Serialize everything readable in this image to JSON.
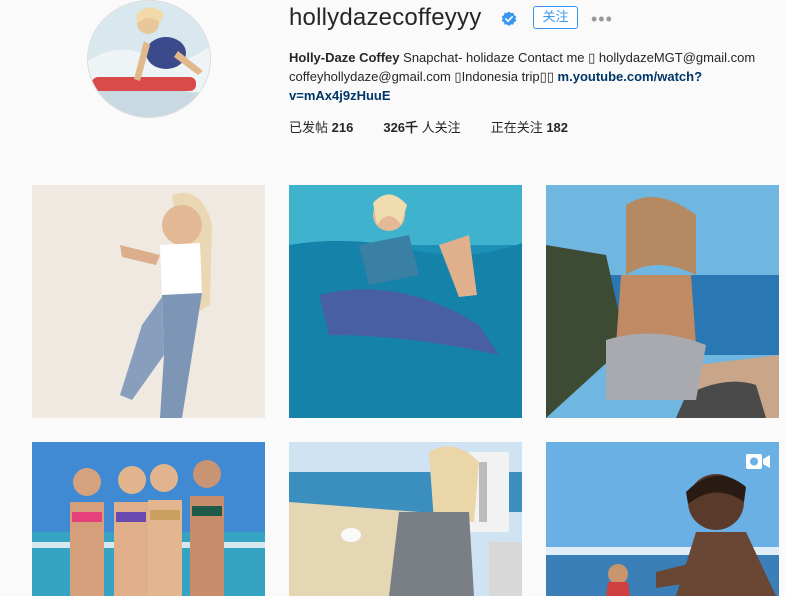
{
  "profile": {
    "username": "hollydazecoffeyyy",
    "follow_label": "关注",
    "more_label": "•••",
    "bio": {
      "name": "Holly-Daze Coffey",
      "line1_text": " Snapchat- holidaze Contact me ▯ hollydazeMGT@gmail.com",
      "line2_text": "coffeyhollydaze@gmail.com ▯Indonesia trip▯▯ ",
      "link_part1": "m.youtube.com/watch?",
      "link_part2": "v=mAx4j9zHuuE"
    },
    "stats": {
      "posts_label": "已发帖",
      "posts_value": "216",
      "followers_value": "326千",
      "followers_label": "人关注",
      "following_label": "正在关注",
      "following_value": "182"
    }
  },
  "grid": {
    "items": [
      {
        "name": "post-1"
      },
      {
        "name": "post-2"
      },
      {
        "name": "post-3"
      },
      {
        "name": "post-4"
      },
      {
        "name": "post-5"
      },
      {
        "name": "post-6",
        "badge": "video-icon"
      }
    ]
  },
  "colors": {
    "accent": "#3897f0",
    "link": "#003569",
    "verified": "#3897f0",
    "background": "#fafafa"
  }
}
